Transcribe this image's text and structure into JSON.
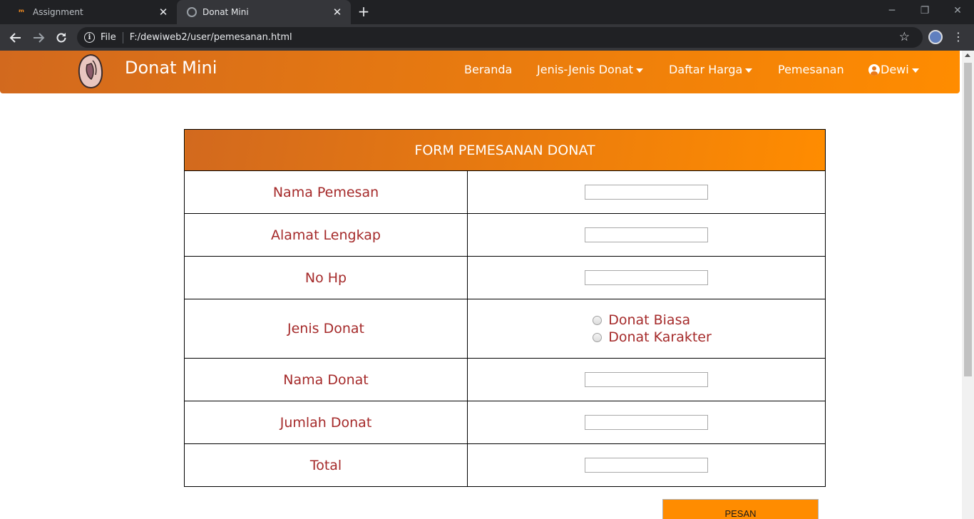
{
  "browser": {
    "tabs": [
      {
        "title": "Assignment",
        "active": false,
        "favicon": "m-logo-icon"
      },
      {
        "title": "Donat Mini",
        "active": true,
        "favicon": "globe-icon"
      }
    ],
    "address": {
      "scheme": "File",
      "url": "F:/dewiweb2/user/pemesanan.html"
    }
  },
  "navbar": {
    "brand": "Donat Mini",
    "menu": [
      {
        "label": "Beranda",
        "dropdown": false
      },
      {
        "label": "Jenis-Jenis Donat",
        "dropdown": true
      },
      {
        "label": "Daftar Harga",
        "dropdown": true
      },
      {
        "label": "Pemesanan",
        "dropdown": false
      }
    ],
    "user": {
      "label": "Dewi",
      "dropdown": true
    }
  },
  "form": {
    "title": "FORM PEMESANAN DONAT",
    "fields": {
      "nama_pemesan": {
        "label": "Nama Pemesan",
        "value": ""
      },
      "alamat": {
        "label": "Alamat Lengkap",
        "value": ""
      },
      "no_hp": {
        "label": "No Hp",
        "value": ""
      },
      "jenis_donat": {
        "label": "Jenis Donat",
        "options": [
          "Donat Biasa",
          "Donat Karakter"
        ]
      },
      "nama_donat": {
        "label": "Nama Donat",
        "value": ""
      },
      "jumlah": {
        "label": "Jumlah Donat",
        "value": ""
      },
      "total": {
        "label": "Total",
        "value": ""
      }
    },
    "submit_label": "PESAN"
  },
  "colors": {
    "accent_start": "#d2691e",
    "accent_end": "#ff8c00",
    "label_text": "#a52a2a"
  }
}
